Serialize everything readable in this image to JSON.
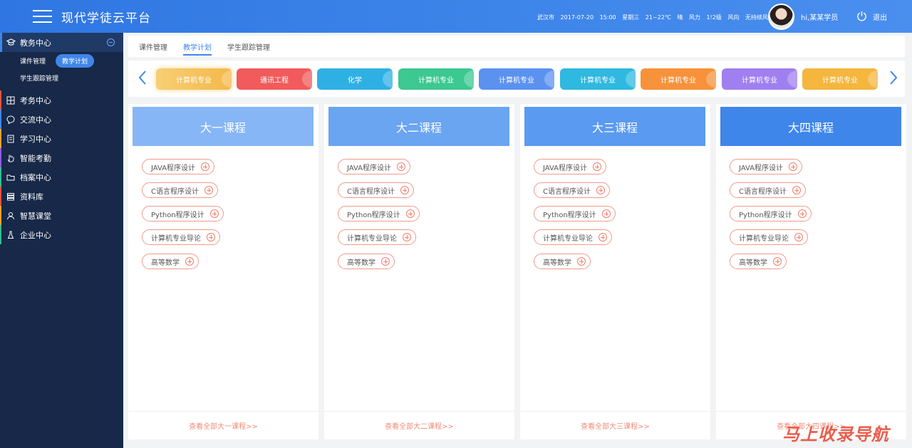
{
  "header": {
    "title": "现代学徒云平台",
    "weather": [
      "武汉市",
      "2017-07-20",
      "15:00",
      "星期三",
      "21~22℃",
      "晴",
      "风力",
      "1!2级",
      "风向",
      "无持续风向微风"
    ],
    "user": "hi,某某学员",
    "logout": "退出"
  },
  "sidebar": {
    "active": {
      "label": "教务中心",
      "icon": "graduation-cap-icon"
    },
    "subitems": [
      {
        "label": "课件管理"
      },
      {
        "label": "教学计划"
      },
      {
        "label": "学生跟踪管理"
      }
    ],
    "items": [
      {
        "label": "考务中心",
        "icon": "grid-icon",
        "color": "#e8533f"
      },
      {
        "label": "交流中心",
        "icon": "chat-icon",
        "color": "#3f86ea"
      },
      {
        "label": "学习中心",
        "icon": "document-icon",
        "color": "#f0a030"
      },
      {
        "label": "智能考勤",
        "icon": "hand-icon",
        "color": "#8e5ae6"
      },
      {
        "label": "档案中心",
        "icon": "folder-icon",
        "color": "#2cbf8f"
      },
      {
        "label": "资料库",
        "icon": "database-icon",
        "color": "#e8533f"
      },
      {
        "label": "智慧课堂",
        "icon": "person-icon",
        "color": "#f0a030"
      },
      {
        "label": "企业中心",
        "icon": "flask-icon",
        "color": "#2cbf8f"
      }
    ]
  },
  "tabs": [
    "课件管理",
    "教学计划",
    "学生跟踪管理"
  ],
  "carousel": [
    {
      "label": "计算机专业",
      "color": "#f6c35a"
    },
    {
      "label": "通讯工程",
      "color": "#f15b5b"
    },
    {
      "label": "化学",
      "color": "#2fb0e5"
    },
    {
      "label": "计算机专业",
      "color": "#3cc890"
    },
    {
      "label": "计算机专业",
      "color": "#5b92f0"
    },
    {
      "label": "计算机专业",
      "color": "#2fb8e0"
    },
    {
      "label": "计算机专业",
      "color": "#f7923a"
    },
    {
      "label": "计算机专业",
      "color": "#a07ff0"
    },
    {
      "label": "计算机专业",
      "color": "#f4b63d"
    }
  ],
  "columns": [
    {
      "title": "大一课程",
      "color": "#86b6f5",
      "footer": "查看全部大一课程>>"
    },
    {
      "title": "大二课程",
      "color": "#6aa5f2",
      "footer": "查看全部大二课程>>"
    },
    {
      "title": "大三课程",
      "color": "#5a9af0",
      "footer": "查看全部大三课程>>"
    },
    {
      "title": "大四课程",
      "color": "#3f86ea",
      "footer": "查看全部大四课程>>"
    }
  ],
  "courses": [
    "JAVA程序设计",
    "C语言程序设计",
    "Python程序设计",
    "计算机专业导论",
    "高等数学"
  ],
  "watermark": "马上收录导航"
}
